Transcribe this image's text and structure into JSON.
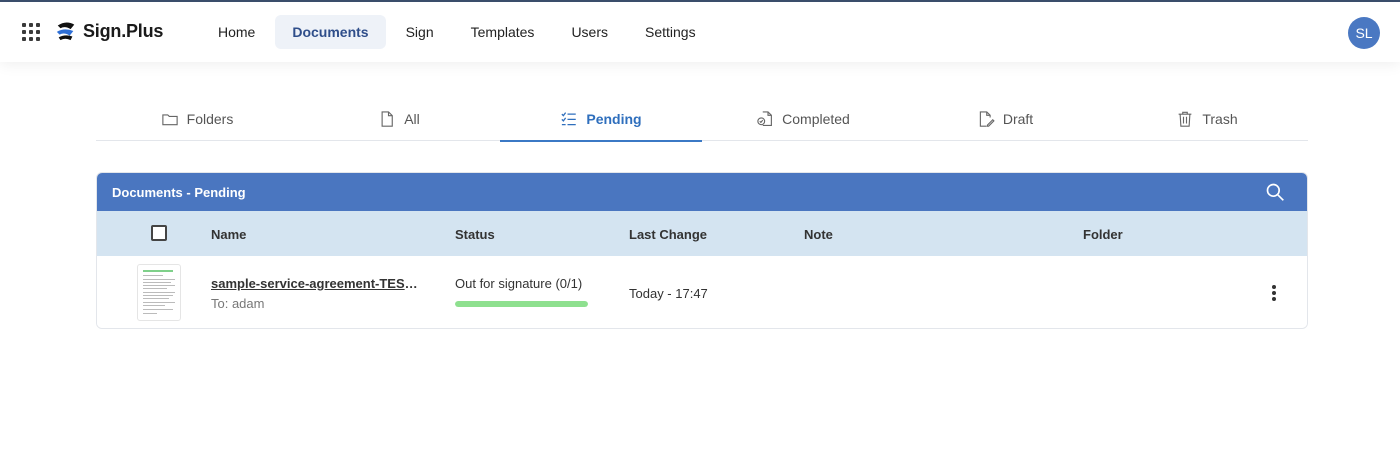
{
  "app": {
    "brand": "Sign.Plus",
    "accent_color": "#4a76c0",
    "header_border_color": "#3c4f6e"
  },
  "nav": {
    "items": [
      {
        "label": "Home",
        "active": false
      },
      {
        "label": "Documents",
        "active": true
      },
      {
        "label": "Sign",
        "active": false
      },
      {
        "label": "Templates",
        "active": false
      },
      {
        "label": "Users",
        "active": false
      },
      {
        "label": "Settings",
        "active": false
      }
    ]
  },
  "user": {
    "initials": "SL",
    "avatar_color": "#4a78c2"
  },
  "tabs": [
    {
      "label": "Folders",
      "icon": "folder-icon",
      "active": false
    },
    {
      "label": "All",
      "icon": "document-icon",
      "active": false
    },
    {
      "label": "Pending",
      "icon": "checklist-icon",
      "active": true
    },
    {
      "label": "Completed",
      "icon": "completed-icon",
      "active": false
    },
    {
      "label": "Draft",
      "icon": "draft-icon",
      "active": false
    },
    {
      "label": "Trash",
      "icon": "trash-icon",
      "active": false
    }
  ],
  "panel": {
    "title": "Documents - Pending",
    "search_icon": "search-icon"
  },
  "table": {
    "columns": {
      "name": "Name",
      "status": "Status",
      "last_change": "Last Change",
      "note": "Note",
      "folder": "Folder"
    },
    "rows": [
      {
        "name": "sample-service-agreement-TEST...",
        "recipient": "To: adam",
        "status": "Out for signature (0/1)",
        "progress_percent": 100,
        "progress_color": "#8ee08f",
        "last_change": "Today - 17:47",
        "note": "",
        "folder": ""
      }
    ]
  }
}
